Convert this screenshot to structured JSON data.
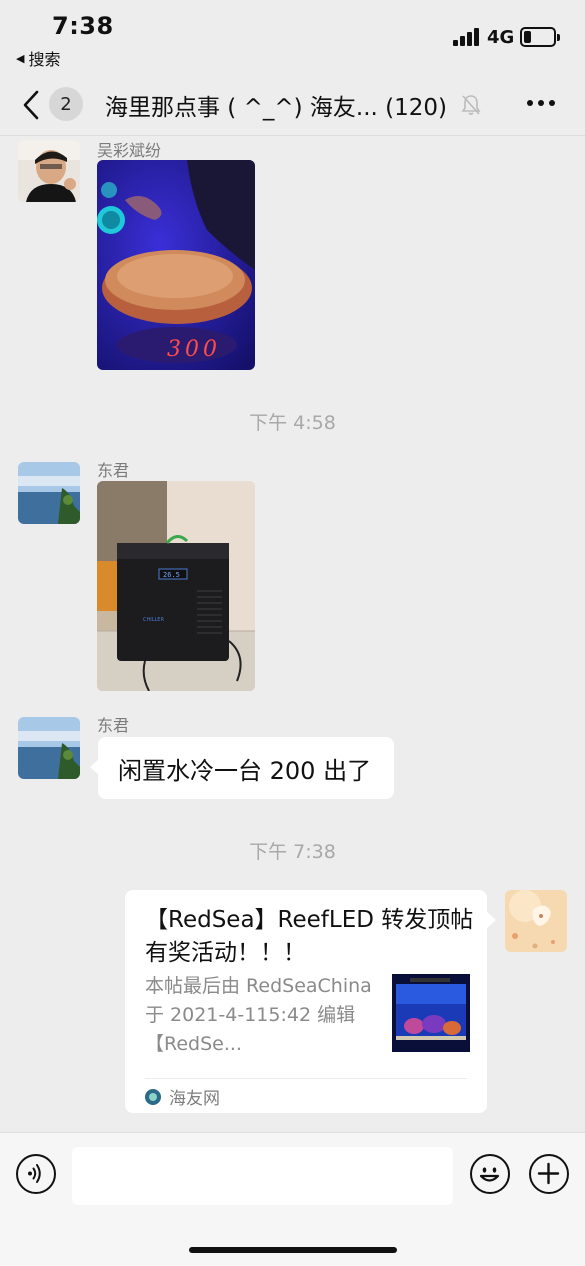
{
  "status_bar": {
    "time": "7:38",
    "back_app": "搜索",
    "network": "4G"
  },
  "nav": {
    "unread_count": "2",
    "title": "海里那点事 ( ^_^) 海友... (120)"
  },
  "messages": [
    {
      "type": "image",
      "sender": "吴彩斌纷",
      "image_text": "300"
    },
    {
      "type": "time",
      "text": "下午 4:58"
    },
    {
      "type": "image",
      "sender": "东君"
    },
    {
      "type": "text",
      "sender": "东君",
      "text": "闲置水冷一台 200 出了"
    },
    {
      "type": "time",
      "text": "下午 7:38"
    },
    {
      "type": "link_card",
      "title": "【RedSea】ReefLED 转发顶帖有奖活动！！！",
      "desc": "本帖最后由 RedSeaChina 于 2021-4-115:42 编辑【RedSe...",
      "source": "海友网"
    }
  ],
  "input": {
    "placeholder": ""
  },
  "icons": {
    "nav_back": "chevron-left-icon",
    "mute": "mute-bell-icon",
    "more": "more-dots-icon",
    "voice": "voice-icon",
    "emoji": "emoji-icon",
    "add": "plus-icon"
  },
  "colors": {
    "background": "#ededed",
    "bubble": "#ffffff",
    "timestamp": "#a8a8a8"
  }
}
